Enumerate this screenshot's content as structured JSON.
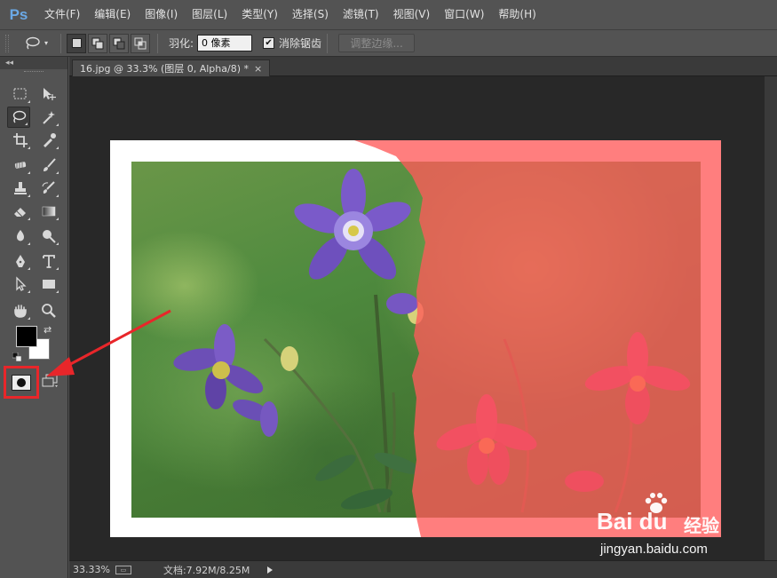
{
  "app": {
    "logo": "Ps"
  },
  "menu": [
    "文件(F)",
    "编辑(E)",
    "图像(I)",
    "图层(L)",
    "类型(Y)",
    "选择(S)",
    "滤镜(T)",
    "视图(V)",
    "窗口(W)",
    "帮助(H)"
  ],
  "options": {
    "feather_label": "羽化:",
    "feather_value": "0 像素",
    "antialias_label": "消除锯齿",
    "antialias_checked": true,
    "refine_edge_label": "调整边缘..."
  },
  "toolbar": {
    "collapse_glyph": "◂◂",
    "active_tool": "lasso-tool",
    "foreground_color": "#000000",
    "background_color": "#ffffff",
    "quick_mask_highlight_color": "#e8262a"
  },
  "document": {
    "tab_title": "16.jpg @ 33.3% (图层 0, Alpha/8) *",
    "tab_close": "×",
    "mask_overlay_color": "#ff5a5a"
  },
  "status": {
    "zoom": "33.33%",
    "doc_size": "文档:7.92M/8.25M"
  },
  "watermark": {
    "brand": "Bai  du",
    "cn": "经验",
    "url": "jingyan.baidu.com"
  }
}
